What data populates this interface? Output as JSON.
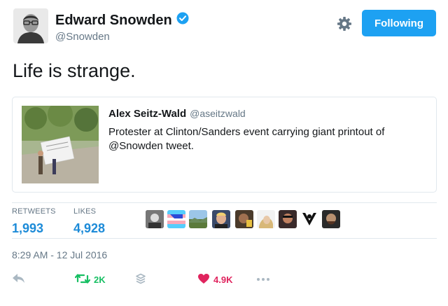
{
  "author": {
    "name": "Edward Snowden",
    "handle": "@Snowden",
    "verified": true
  },
  "follow_button": {
    "label": "Following"
  },
  "tweet": {
    "text": "Life is strange."
  },
  "quoted_tweet": {
    "author_name": "Alex Seitz-Wald",
    "author_handle": "@aseitzwald",
    "text": "Protester at Clinton/Sanders event carrying giant printout of @Snowden tweet."
  },
  "stats": {
    "retweets_label": "RETWEETS",
    "retweets_value": "1,993",
    "likes_label": "LIKES",
    "likes_value": "4,928"
  },
  "timestamp": "8:29 AM - 12 Jul 2016",
  "actions": {
    "retweet_count": "2K",
    "like_count": "4.9K"
  },
  "colors": {
    "accent": "#1da1f2",
    "stat_value": "#1d8bd8",
    "retweet": "#17bf63",
    "like": "#e0245e",
    "muted": "#657786",
    "divider": "#e1e8ed"
  },
  "liker_avatars": [
    "avatar-1",
    "avatar-2",
    "avatar-3",
    "avatar-4",
    "avatar-5",
    "avatar-6",
    "avatar-7",
    "avatar-8",
    "avatar-9"
  ]
}
